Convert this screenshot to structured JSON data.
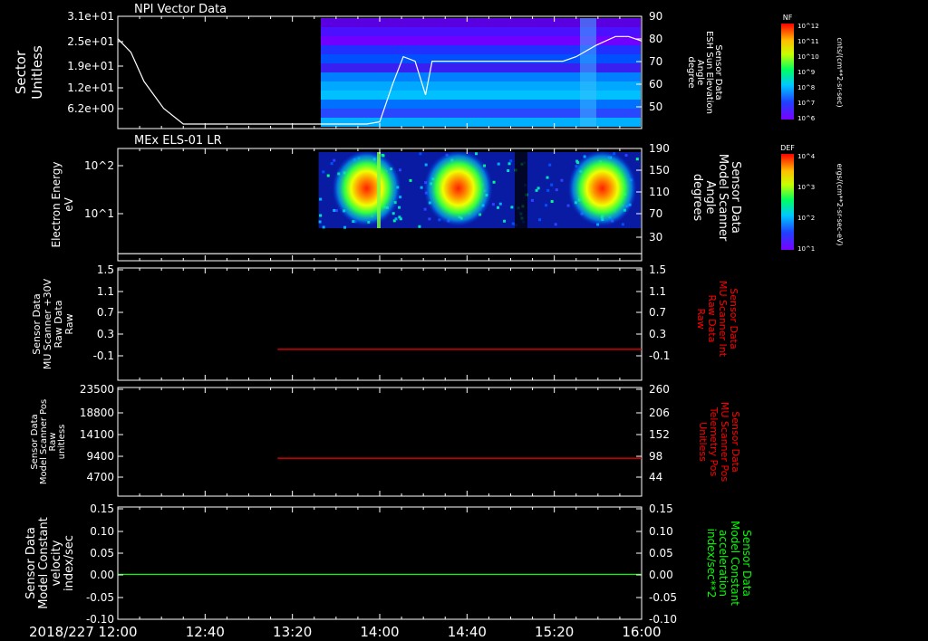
{
  "page": {
    "date_label": "2018/227",
    "time_ticks": [
      "12:00",
      "12:40",
      "13:20",
      "14:00",
      "14:40",
      "15:20",
      "16:00"
    ]
  },
  "chart_data": [
    {
      "type": "heatmap",
      "panel": "npi",
      "title": "NPI Vector Data",
      "ylabel_left": [
        "Sector",
        "Unitless"
      ],
      "yticks_left": [
        "3.1e+01",
        "2.5e+01",
        "1.9e+01",
        "1.2e+01",
        "6.2e+00"
      ],
      "ylabel_right": [
        "Sensor Data",
        "ESH Sun Elevation",
        "Angle",
        "degree"
      ],
      "yticks_right": [
        "90",
        "80",
        "70",
        "60",
        "50"
      ],
      "ylim_right": [
        40,
        90
      ],
      "data_start": "13:33",
      "colorbar": {
        "label": "NF",
        "units": "cnts/(cm**2-sr-sec)",
        "ticks": [
          "10^12",
          "10^11",
          "10^10",
          "10^9",
          "10^8",
          "10^7",
          "10^6"
        ]
      },
      "line": {
        "color": "#ffffff",
        "t_hours": [
          0.0,
          0.1,
          0.2,
          0.35,
          0.5,
          0.7,
          1.0,
          1.3,
          1.6,
          1.9,
          2.0,
          2.1,
          2.18,
          2.27,
          2.35,
          2.4,
          2.5,
          2.8,
          3.2,
          3.4,
          3.5,
          3.65,
          3.8,
          3.9,
          4.0
        ],
        "values": [
          80,
          74,
          61,
          49,
          42,
          42,
          42,
          42,
          42,
          42,
          43,
          60,
          72,
          70,
          55,
          70,
          70,
          70,
          70,
          70,
          72,
          77,
          81,
          81,
          79
        ]
      }
    },
    {
      "type": "heatmap",
      "panel": "els",
      "title": "MEx ELS-01 LR",
      "ylabel_left": [
        "Electron Energy",
        "eV"
      ],
      "yticks_left": [
        "10^2",
        "10^1"
      ],
      "ylabel_right": [
        "Sensor Data",
        "Model Scanner",
        "Angle",
        "degrees"
      ],
      "yticks_right": [
        "190",
        "150",
        "110",
        "70",
        "30"
      ],
      "ylim_right": [
        0,
        190
      ],
      "data_start": "13:32",
      "hot_spots_hours": [
        1.9,
        2.6,
        3.7
      ],
      "colorbar": {
        "label": "DEF",
        "units": "ergs/(cm**2-sr-sec-eV)",
        "ticks": [
          "10^4",
          "10^3",
          "10^2",
          "10^1"
        ]
      },
      "line": {
        "color": "#ffffff",
        "t_hours": [
          0,
          4
        ],
        "values": [
          12,
          12
        ]
      }
    },
    {
      "type": "line",
      "panel": "mu_raw",
      "ylabel_left": [
        "Sensor Data",
        "MU Scanner +30V",
        "Raw Data",
        "Raw"
      ],
      "yticks_left": [
        "1.5",
        "1.1",
        "0.7",
        "0.3",
        "-0.1"
      ],
      "ylim": [
        -0.5,
        1.5
      ],
      "ylabel_right": [
        "Sensor Data",
        "MU Scanner Int",
        "Raw Data",
        "Raw"
      ],
      "yticks_right": [
        "1.5",
        "1.1",
        "0.7",
        "0.3",
        "-0.1"
      ],
      "right_label_color": "#ff0000",
      "series": [
        {
          "color": "#ff0000",
          "t_hours": [
            1.22,
            4.0
          ],
          "values": [
            0.05,
            0.05
          ]
        }
      ]
    },
    {
      "type": "line",
      "panel": "pos",
      "ylabel_left": [
        "Sensor Data",
        "Model Scanner Pos",
        "Raw",
        "unitless"
      ],
      "yticks_left": [
        "23500",
        "18800",
        "14100",
        "9400",
        "4700"
      ],
      "ylim": [
        0,
        23500
      ],
      "ylabel_right": [
        "Sensor Data",
        "MU Scanner Pos",
        "Telemetry Pos",
        "Unitless"
      ],
      "yticks_right": [
        "260",
        "206",
        "152",
        "98",
        "44"
      ],
      "right_label_color": "#ff0000",
      "series": [
        {
          "color": "#ff0000",
          "t_hours": [
            1.22,
            4.0
          ],
          "values": [
            8200,
            8200
          ]
        }
      ]
    },
    {
      "type": "line",
      "panel": "vel",
      "ylabel_left": [
        "Sensor Data",
        "Model Constant",
        "velocity",
        "index/sec"
      ],
      "yticks_left": [
        "0.15",
        "0.10",
        "0.05",
        "0.00",
        "-0.05",
        "-0.10"
      ],
      "ylim": [
        -0.1,
        0.15
      ],
      "ylabel_right": [
        "Sensor Data",
        "Model Constant",
        "acceleration",
        "index/sec**2"
      ],
      "yticks_right": [
        "0.15",
        "0.10",
        "0.05",
        "0.00",
        "-0.05",
        "-0.10"
      ],
      "right_label_color": "#00ff00",
      "series": [
        {
          "color": "#00ff00",
          "t_hours": [
            0,
            4.0
          ],
          "values": [
            0,
            0
          ]
        }
      ]
    }
  ]
}
